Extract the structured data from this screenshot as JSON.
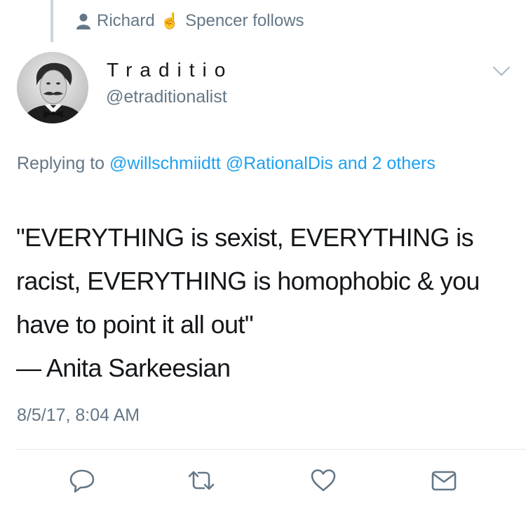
{
  "context": {
    "icon": "person-icon",
    "name_part_1": "Richard",
    "emoji": "☝️",
    "name_part_2": "Spencer follows"
  },
  "tweet": {
    "author": {
      "display_name": "Traditio",
      "handle": "@etraditionalist",
      "avatar": "avatar"
    },
    "replying": {
      "prefix": "Replying to",
      "mention_1": "@willschmiidtt",
      "mention_2": "@RationalDis",
      "others": "and 2 others"
    },
    "text": "\"EVERYTHING is sexist, EVERYTHING is racist, EVERYTHING is homophobic & you have to point it all out\"\n— Anita Sarkeesian",
    "timestamp": "8/5/17, 8:04 AM"
  },
  "actions": [
    "reply-icon",
    "retweet-icon",
    "like-icon",
    "direct-message-icon"
  ],
  "colors": {
    "link": "#1da1f2",
    "secondary_text": "#657786",
    "primary_text": "#14171a",
    "divider": "#e1e8ed"
  }
}
